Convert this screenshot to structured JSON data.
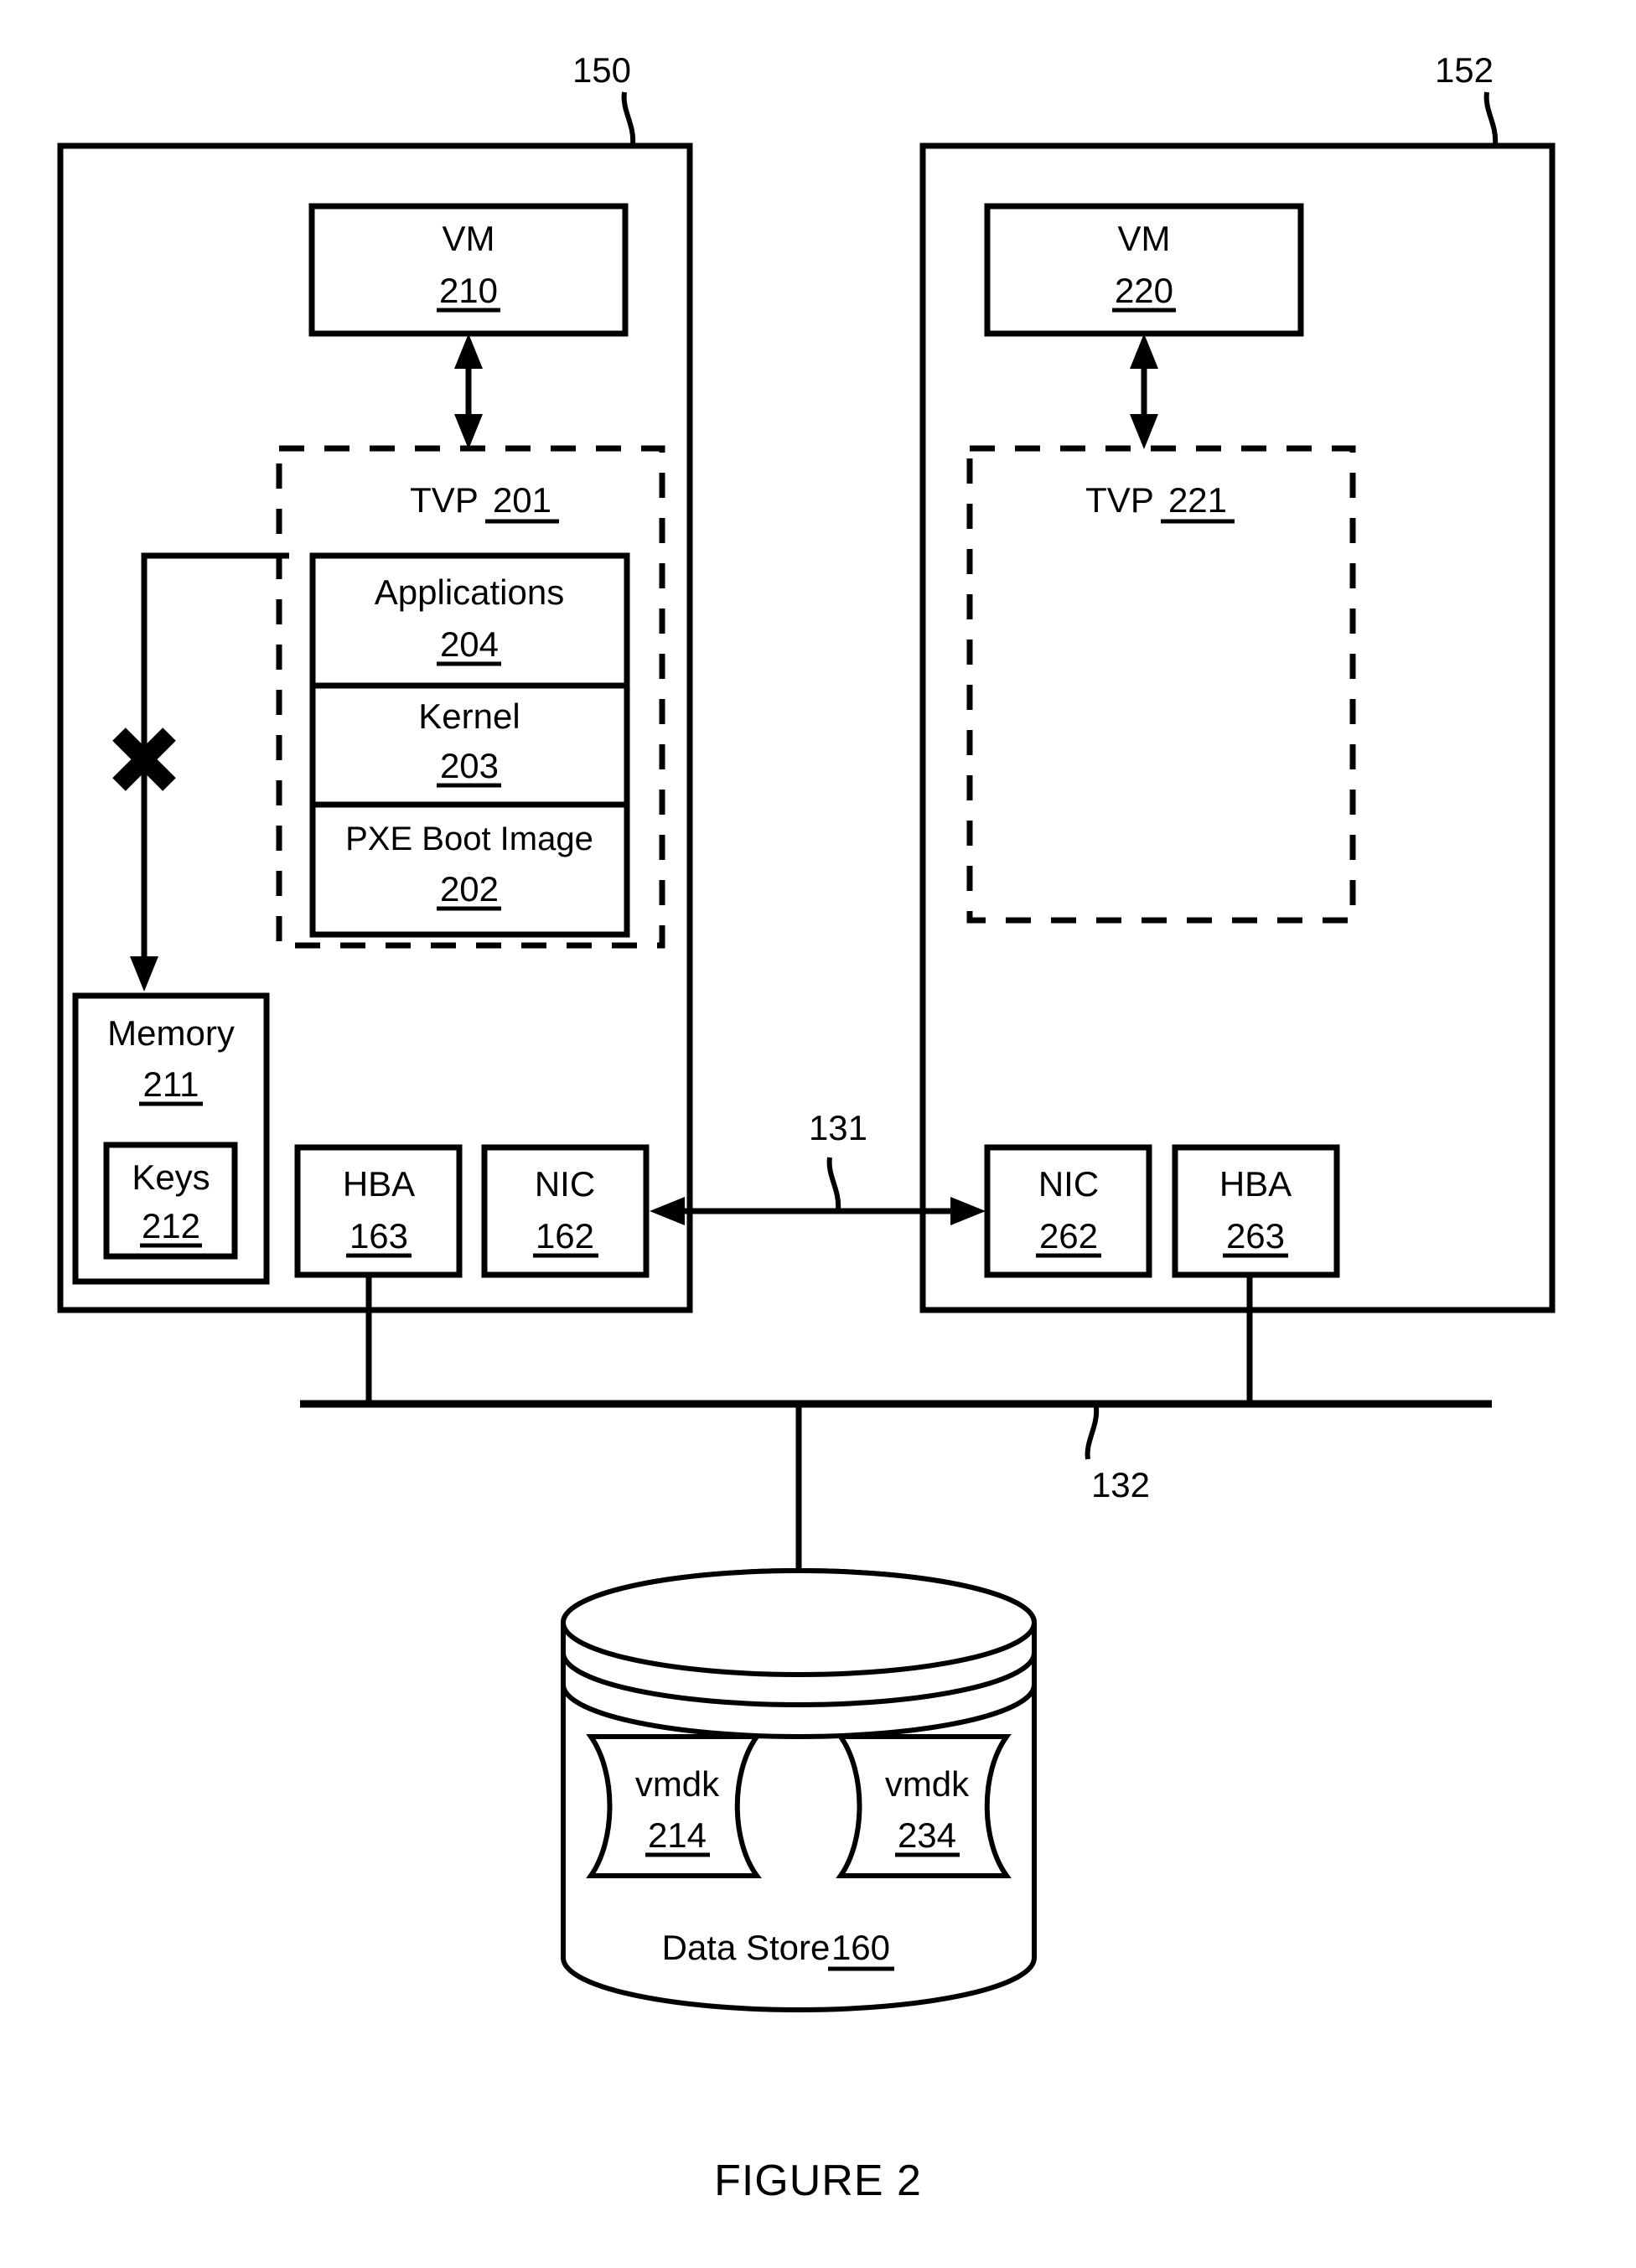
{
  "figure": {
    "caption": "FIGURE 2"
  },
  "hosts": [
    {
      "ref": "150",
      "vm": {
        "label": "VM",
        "ref": "210"
      },
      "tvp": {
        "label": "TVP",
        "ref": "201"
      },
      "stack": [
        {
          "label": "Applications",
          "ref": "204"
        },
        {
          "label": "Kernel",
          "ref": "203"
        },
        {
          "label": "PXE Boot Image",
          "ref": "202"
        }
      ],
      "memory": {
        "label": "Memory",
        "ref": "211"
      },
      "keys": {
        "label": "Keys",
        "ref": "212"
      },
      "hba": {
        "label": "HBA",
        "ref": "163"
      },
      "nic": {
        "label": "NIC",
        "ref": "162"
      },
      "blocked_marker": "X"
    },
    {
      "ref": "152",
      "vm": {
        "label": "VM",
        "ref": "220"
      },
      "tvp": {
        "label": "TVP",
        "ref": "221"
      },
      "stack": [],
      "nic": {
        "label": "NIC",
        "ref": "262"
      },
      "hba": {
        "label": "HBA",
        "ref": "263"
      }
    }
  ],
  "links": {
    "network": {
      "ref": "131"
    },
    "storage_bus": {
      "ref": "132"
    }
  },
  "datastore": {
    "label": "Data Store",
    "ref": "160",
    "disks": [
      {
        "label": "vmdk",
        "ref": "214"
      },
      {
        "label": "vmdk",
        "ref": "234"
      }
    ]
  },
  "colors": {
    "stroke": "#000000",
    "fill": "#ffffff"
  }
}
